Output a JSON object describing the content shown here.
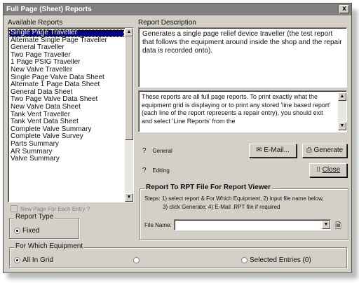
{
  "window": {
    "title": "Full Page (Sheet) Reports",
    "close_glyph": "x"
  },
  "left": {
    "available_label": "Available Reports",
    "reports": [
      "Single Page Traveller",
      "Alternate Single Page Traveller",
      "General Traveller",
      "Two Page Traveller",
      "1 Page PSIG Traveller",
      "New Valve Traveller",
      "Single Page Valve Data Sheet",
      "Alternate 1 Page Data Sheet",
      "General Data Sheet",
      "Two Page Valve Data Sheet",
      "New Valve Data Sheet",
      "Tank Vent Traveller",
      "Tank Vent Data Sheet",
      "Complete Valve Summary",
      "Complete Valve Survey",
      "Parts Summary",
      "AR Summary",
      "Valve Summary"
    ],
    "new_page_label": "New Page For Each Entry ?",
    "report_type_label": "Report Type",
    "fixed_label": "Fixed"
  },
  "right": {
    "description_label": "Report Description",
    "description_text": "Generates a single page relief device traveller (the test report that follows the equipment around inside the shop and the repair data is recorded onto).",
    "info_text": "These reports are all full page reports. To print exactly what the equipment grid is displaying or to print any stored 'line based report' (each line of the report represents a repair entry), you should exit and select 'Line Reports' from the",
    "general_label": "General",
    "editing_label": "Editing",
    "email_label": "E-Mail...",
    "generate_label": "Generate",
    "close_label": "Close",
    "rpt_group_label": "Report To RPT File For Report Viewer",
    "rpt_steps_1": "Steps: 1) select report & For Which Equipment,  2) input file name below,",
    "rpt_steps_2": "3) click Generate; 4) E-Mail .RPT file if required",
    "file_name_label": "File Name:",
    "file_name_value": ""
  },
  "equipment": {
    "label": "For Which Equipment",
    "all_in_grid": "All In Grid",
    "selected_entries": "Selected Entries (0)"
  }
}
